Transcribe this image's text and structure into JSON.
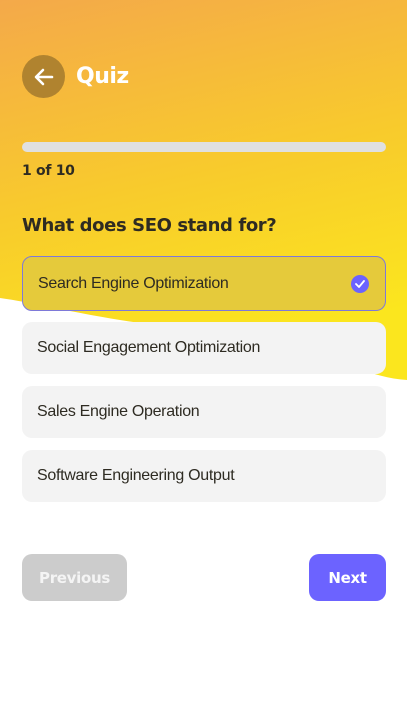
{
  "header": {
    "title": "Quiz",
    "back_icon": "arrow-left-icon"
  },
  "progress": {
    "fraction": 0.0,
    "counter_text": "1 of 10"
  },
  "question": {
    "text": "What does SEO stand for?"
  },
  "options": [
    {
      "label": "Search Engine Optimization",
      "selected": true
    },
    {
      "label": "Social Engagement Optimization",
      "selected": false
    },
    {
      "label": "Sales Engine Operation",
      "selected": false
    },
    {
      "label": "Software Engineering Output",
      "selected": false
    }
  ],
  "footer": {
    "previous_label": "Previous",
    "next_label": "Next"
  },
  "colors": {
    "gradient_top": "#f4a94a",
    "gradient_bottom": "#fbe620",
    "accent": "#6c63ff",
    "selected_option": "#e5ca3b",
    "option_bg": "#f3f3f3",
    "disabled_button": "#cccccc",
    "back_button": "#b0832f"
  }
}
